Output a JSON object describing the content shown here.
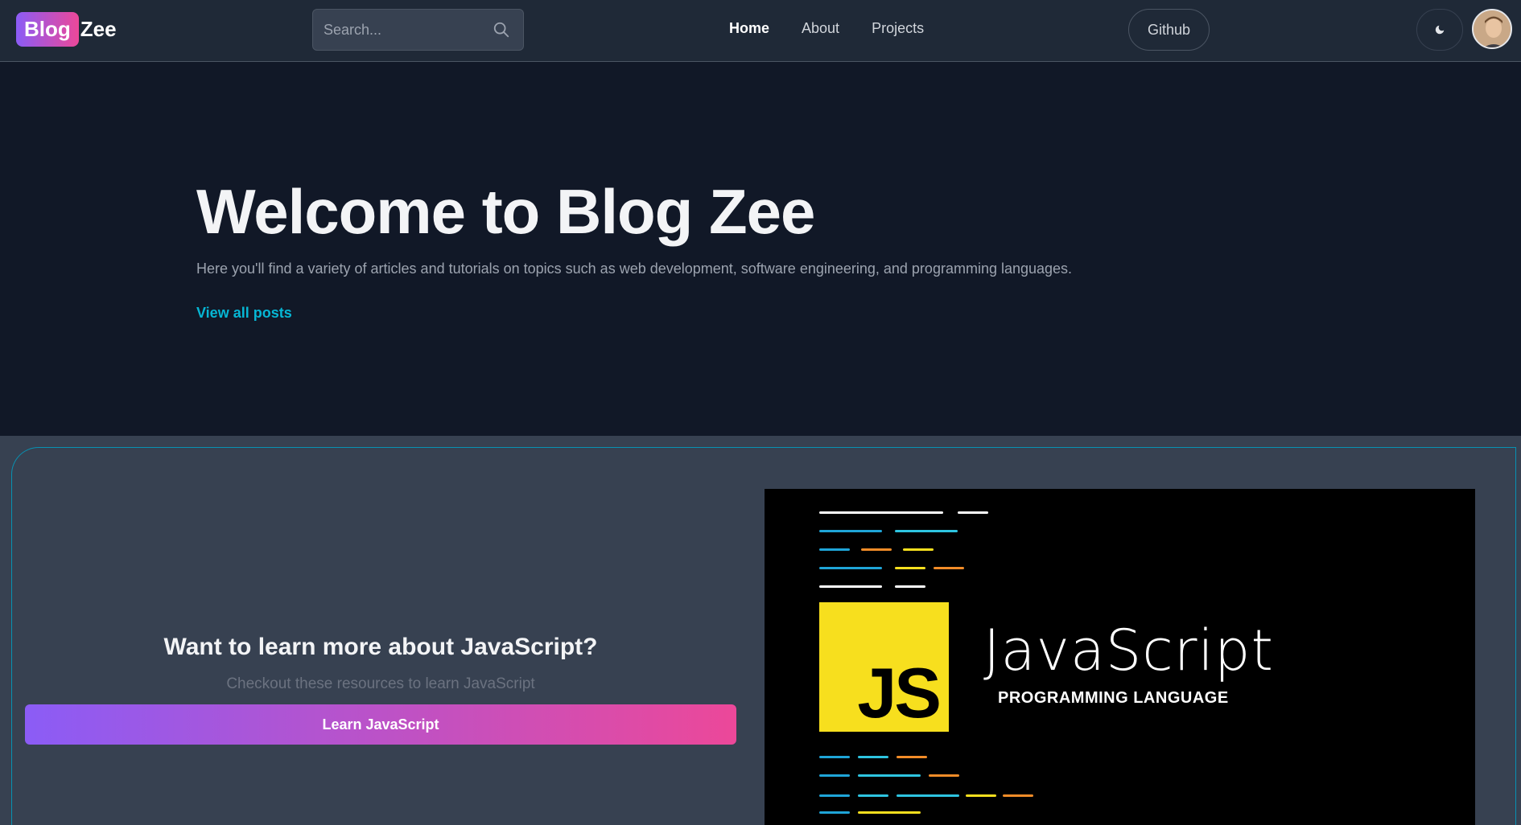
{
  "header": {
    "logo_part1": "Blog",
    "logo_part2": "Zee",
    "search_placeholder": "Search...",
    "nav": [
      {
        "label": "Home",
        "active": true
      },
      {
        "label": "About",
        "active": false
      },
      {
        "label": "Projects",
        "active": false
      }
    ],
    "github_label": "Github",
    "theme_icon": "moon-icon",
    "avatar_icon": "avatar"
  },
  "hero": {
    "title": "Welcome to Blog Zee",
    "subtitle": "Here you'll find a variety of articles and tutorials on topics such as web development, software engineering, and programming languages.",
    "link_label": "View all posts"
  },
  "promo": {
    "title": "Want to learn more about JavaScript?",
    "subtitle": "Checkout these resources to learn JavaScript",
    "button_label": "Learn JavaScript",
    "image": {
      "badge": "JS",
      "wordmark": "JavaScript",
      "tagline": "PROGRAMMING LANGUAGE"
    }
  },
  "colors": {
    "accent_gradient_start": "#8b5cf6",
    "accent_gradient_end": "#ec4899",
    "link": "#06b6d4",
    "js_yellow": "#f7df1e"
  }
}
